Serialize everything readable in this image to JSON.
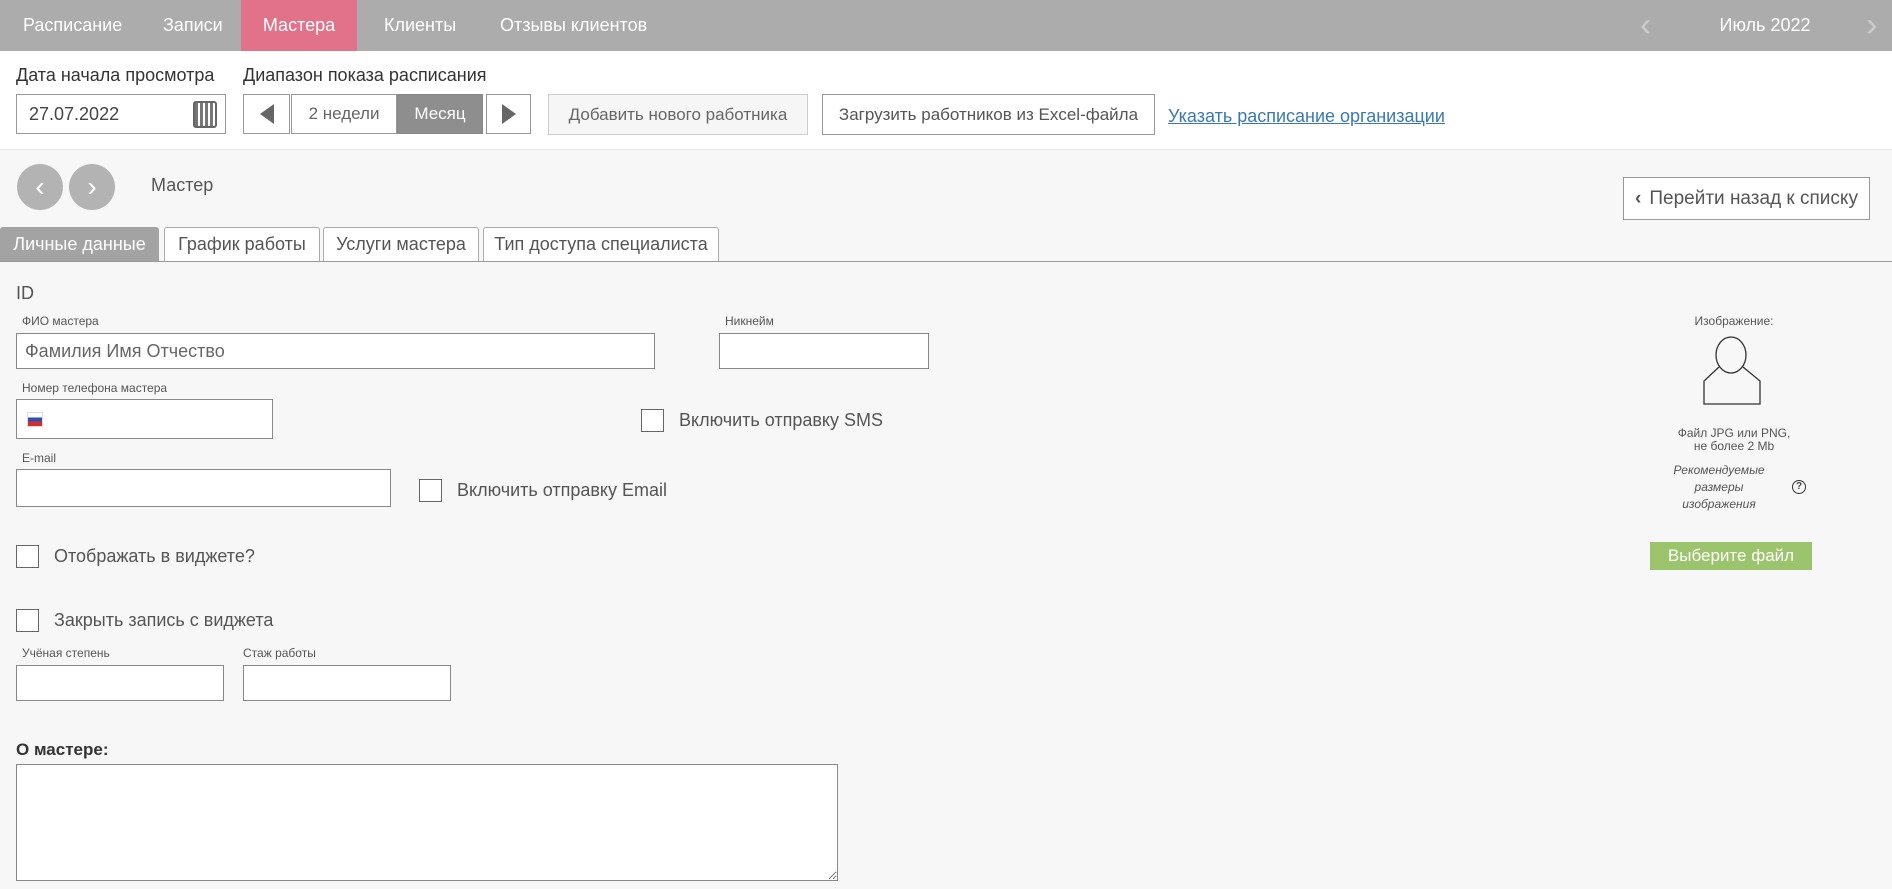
{
  "nav": {
    "items": [
      "Расписание",
      "Записи",
      "Мастера",
      "Клиенты",
      "Отзывы клиентов"
    ],
    "active": "Мастера",
    "month": "Июль 2022"
  },
  "toolbar": {
    "date_label": "Дата начала просмотра",
    "date_value": "27.07.2022",
    "range_label": "Диапазон показа расписания",
    "range_options": [
      "2 недели",
      "Месяц"
    ],
    "range_selected": "Месяц",
    "add_worker": "Добавить нового работника",
    "upload_excel": "Загрузить работников из Excel-файла",
    "org_schedule_link": "Указать расписание организации"
  },
  "header": {
    "title": "Мастер",
    "back_button": "Перейти назад к списку"
  },
  "tabs": [
    "Личные данные",
    "График работы",
    "Услуги мастера",
    "Тип доступа специалиста"
  ],
  "form": {
    "id_label": "ID",
    "fio_label": "ФИО мастера",
    "fio_placeholder": "Фамилия Имя Отчество",
    "nickname_label": "Никнейм",
    "phone_label": "Номер телефона мастера",
    "sms_label": "Включить отправку SMS",
    "email_label": "E-mail",
    "email_send_label": "Включить отправку Email",
    "widget_show_label": "Отображать в виджете?",
    "widget_close_label": "Закрыть запись с виджета",
    "degree_label": "Учёная степень",
    "experience_label": "Стаж работы",
    "about_label": "О мастере:"
  },
  "image": {
    "label": "Изображение:",
    "hint1": "Файл JPG или PNG,",
    "hint2": "не более 2 Mb",
    "recommend": "Рекомендуемые размеры изображения",
    "choose_file": "Выберите файл"
  },
  "colors": {
    "nav_bg": "#acacac",
    "nav_active": "#e2728a",
    "file_button": "#9bc46d",
    "link": "#3a78b5"
  }
}
